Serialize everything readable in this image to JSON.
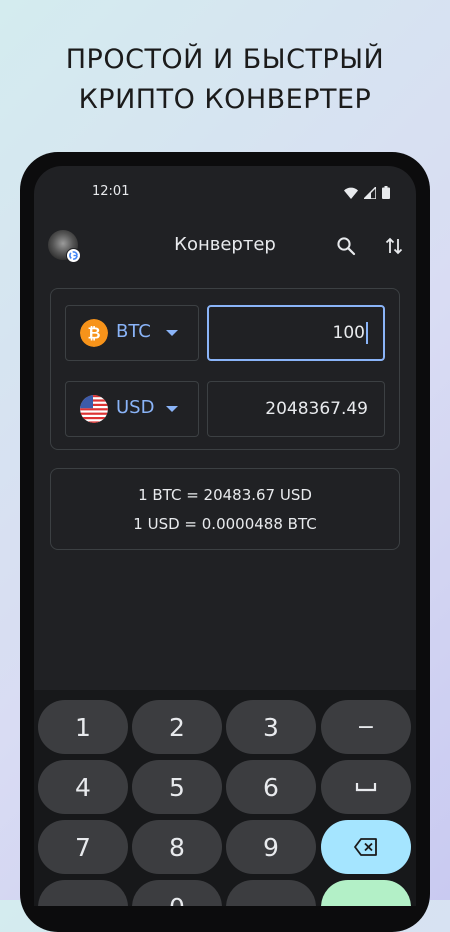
{
  "headline": {
    "line1": "ПРОСТОЙ И БЫСТРЫЙ",
    "line2": "КРИПТО КОНВЕРТЕР"
  },
  "status_bar": {
    "time": "12:01",
    "icons": [
      "wifi-icon",
      "signal-icon",
      "battery-icon"
    ]
  },
  "app_bar": {
    "title": "Конвертер",
    "icons": [
      "avatar",
      "search-icon",
      "swap-vertical-icon"
    ]
  },
  "converter": {
    "from": {
      "currency": "BTC",
      "amount": "100",
      "icon": "bitcoin-icon",
      "color": "#f7931a"
    },
    "to": {
      "currency": "USD",
      "amount": "2048367.49",
      "icon": "us-flag-icon"
    }
  },
  "rates": {
    "line1": "1 BTC = 20483.67 USD",
    "line2": "1 USD = 0.0000488 BTC"
  },
  "keypad": {
    "keys": [
      "1",
      "2",
      "3",
      "−",
      "4",
      "5",
      "6",
      "⎵",
      "7",
      "8",
      "9",
      "⌫",
      "0"
    ],
    "colors": {
      "key": "#3c3d40",
      "delete": "#a5e5ff",
      "submit": "#b3f0c7"
    }
  },
  "colors": {
    "accent": "#8ab4f8",
    "background": "#202124"
  }
}
